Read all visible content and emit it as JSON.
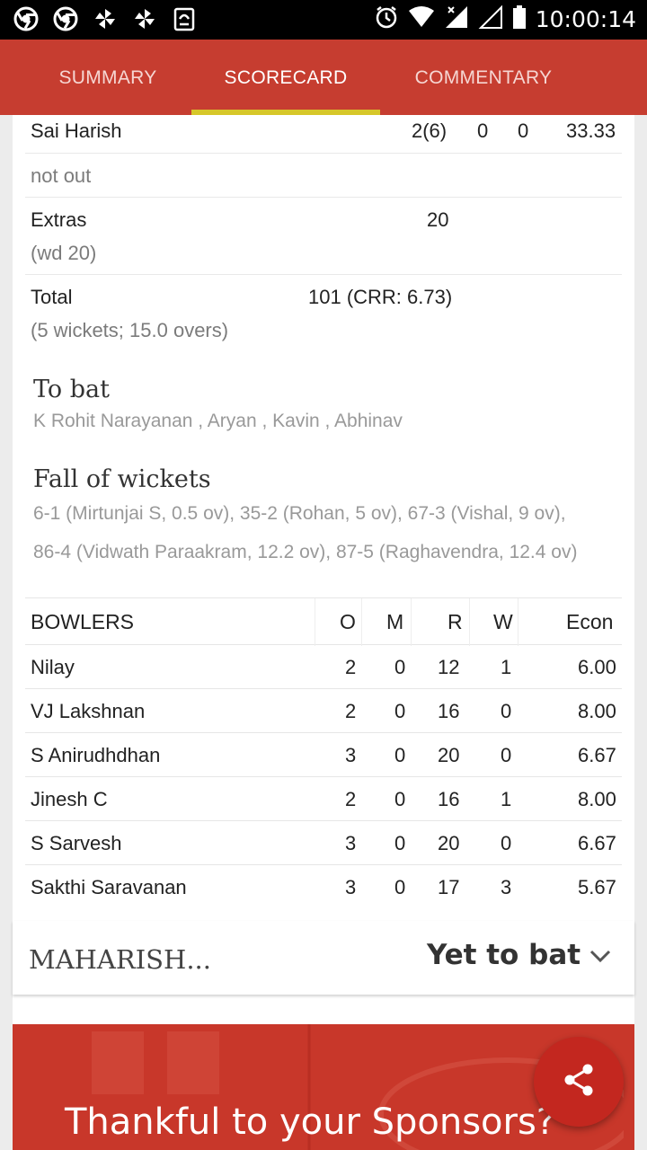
{
  "status_bar": {
    "time": "10:00:14",
    "left_icons": [
      "chrome-icon",
      "chrome-icon",
      "pinwheel-icon",
      "pinwheel-icon",
      "clipboard-icon"
    ],
    "right_icons": [
      "alarm-icon",
      "wifi-icon",
      "signal-icon",
      "signal-empty-icon",
      "battery-icon"
    ]
  },
  "tabs": [
    {
      "label": "SUMMARY"
    },
    {
      "label": "SCORECARD"
    },
    {
      "label": "COMMENTARY"
    }
  ],
  "active_tab": "SCORECARD",
  "accent_color": "#c63d30",
  "tab_indicator_color": "#d6c72a",
  "batsman": {
    "name": "Sai Harish",
    "runs_balls": "2(6)",
    "fours": "0",
    "sixes": "0",
    "strike_rate": "33.33",
    "dismissal": "not out"
  },
  "extras": {
    "label": "Extras",
    "detail": "(wd 20)",
    "value": "20"
  },
  "total": {
    "label": "Total",
    "detail": "(5 wickets; 15.0 overs)",
    "value": "101 (CRR: 6.73)"
  },
  "to_bat": {
    "heading": "To bat",
    "players": "K Rohit Narayanan , Aryan , Kavin , Abhinav"
  },
  "fall_of_wickets": {
    "heading": "Fall of wickets",
    "line1": "6-1 (Mirtunjai S, 0.5 ov), 35-2 (Rohan, 5 ov), 67-3 (Vishal, 9 ov),",
    "line2": "86-4 (Vidwath Paraakram, 12.2 ov), 87-5 (Raghavendra, 12.4 ov)"
  },
  "bowlers": {
    "headers": {
      "name": "BOWLERS",
      "o": "O",
      "m": "M",
      "r": "R",
      "w": "W",
      "econ": "Econ"
    },
    "rows": [
      {
        "name": "Nilay",
        "o": "2",
        "m": "0",
        "r": "12",
        "w": "1",
        "econ": "6.00"
      },
      {
        "name": "VJ Lakshnan",
        "o": "2",
        "m": "0",
        "r": "16",
        "w": "0",
        "econ": "8.00"
      },
      {
        "name": "S Anirudhdhan",
        "o": "3",
        "m": "0",
        "r": "20",
        "w": "0",
        "econ": "6.67"
      },
      {
        "name": "Jinesh C",
        "o": "2",
        "m": "0",
        "r": "16",
        "w": "1",
        "econ": "8.00"
      },
      {
        "name": "S Sarvesh",
        "o": "3",
        "m": "0",
        "r": "20",
        "w": "0",
        "econ": "6.67"
      },
      {
        "name": "Sakthi Saravanan",
        "o": "3",
        "m": "0",
        "r": "17",
        "w": "3",
        "econ": "5.67"
      }
    ]
  },
  "second_team": {
    "name": "MAHARISH...",
    "status": "Yet to bat"
  },
  "sponsor": {
    "text": "Thankful to your Sponsors?"
  }
}
